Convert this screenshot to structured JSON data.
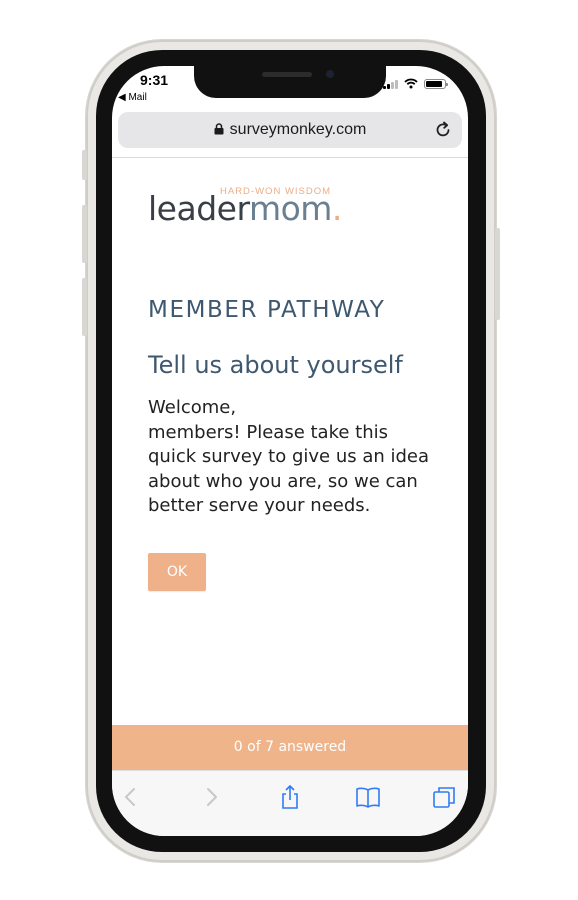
{
  "status_bar": {
    "time": "9:31",
    "back_app": "◀ Mail"
  },
  "browser": {
    "url": "surveymonkey.com"
  },
  "logo": {
    "tagline": "HARD-WON WISDOM",
    "part1": "leader",
    "part2": "mom",
    "dot": "."
  },
  "survey": {
    "title": "MEMBER PATHWAY",
    "subtitle": "Tell us about yourself",
    "body_lines": [
      "Welcome,",
      "members! Please take this",
      "quick survey to give us an idea",
      "about who you are, so we can",
      "better serve your needs."
    ],
    "ok_label": "OK"
  },
  "progress": {
    "text": "0 of 7 answered",
    "answered": 0,
    "total": 7
  },
  "toolbar": {
    "icons": [
      "back-icon",
      "forward-icon",
      "share-icon",
      "bookmarks-icon",
      "tabs-icon"
    ],
    "accent_color": "#2f7bf5",
    "disabled_color": "#c7c7cc"
  },
  "colors": {
    "brand_peach": "#efb48a",
    "heading_blue": "#3e5870",
    "logo_dark": "#3a3f47",
    "logo_slate": "#6b7f93"
  }
}
